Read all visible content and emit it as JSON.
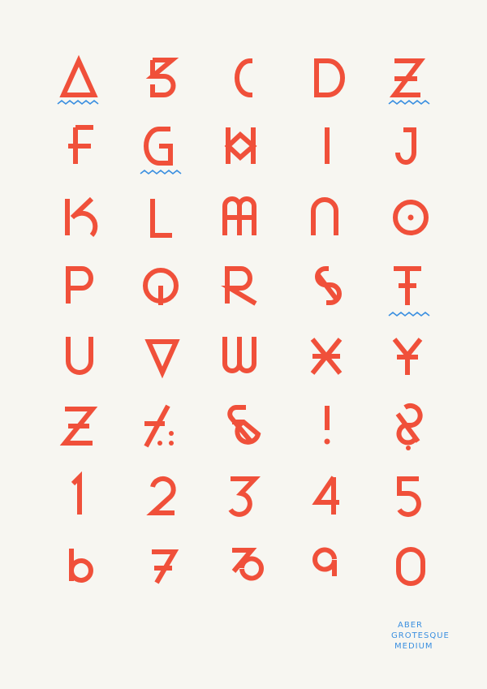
{
  "poster": {
    "background": "#f7f6f1",
    "glyph_color": "#f0503a",
    "accent_color": "#3a8fe0",
    "glyphs": [
      "A",
      "B",
      "C",
      "D",
      "E",
      "F",
      "G",
      "H",
      "I",
      "J",
      "K",
      "L",
      "M",
      "N",
      "O",
      "P",
      "Q",
      "R",
      "S",
      "T",
      "U",
      "V",
      "W",
      "X",
      "Y",
      "Z",
      "/.:,",
      "&",
      "!",
      "?",
      "1",
      "2",
      "3",
      "4",
      "5",
      "6",
      "7",
      "8",
      "9",
      "0"
    ],
    "underlined_glyphs": [
      "A",
      "E",
      "G",
      "T"
    ],
    "credit": {
      "line1": "ABER",
      "line2": "GROTESQUE",
      "line3": "MEDIUM"
    }
  }
}
